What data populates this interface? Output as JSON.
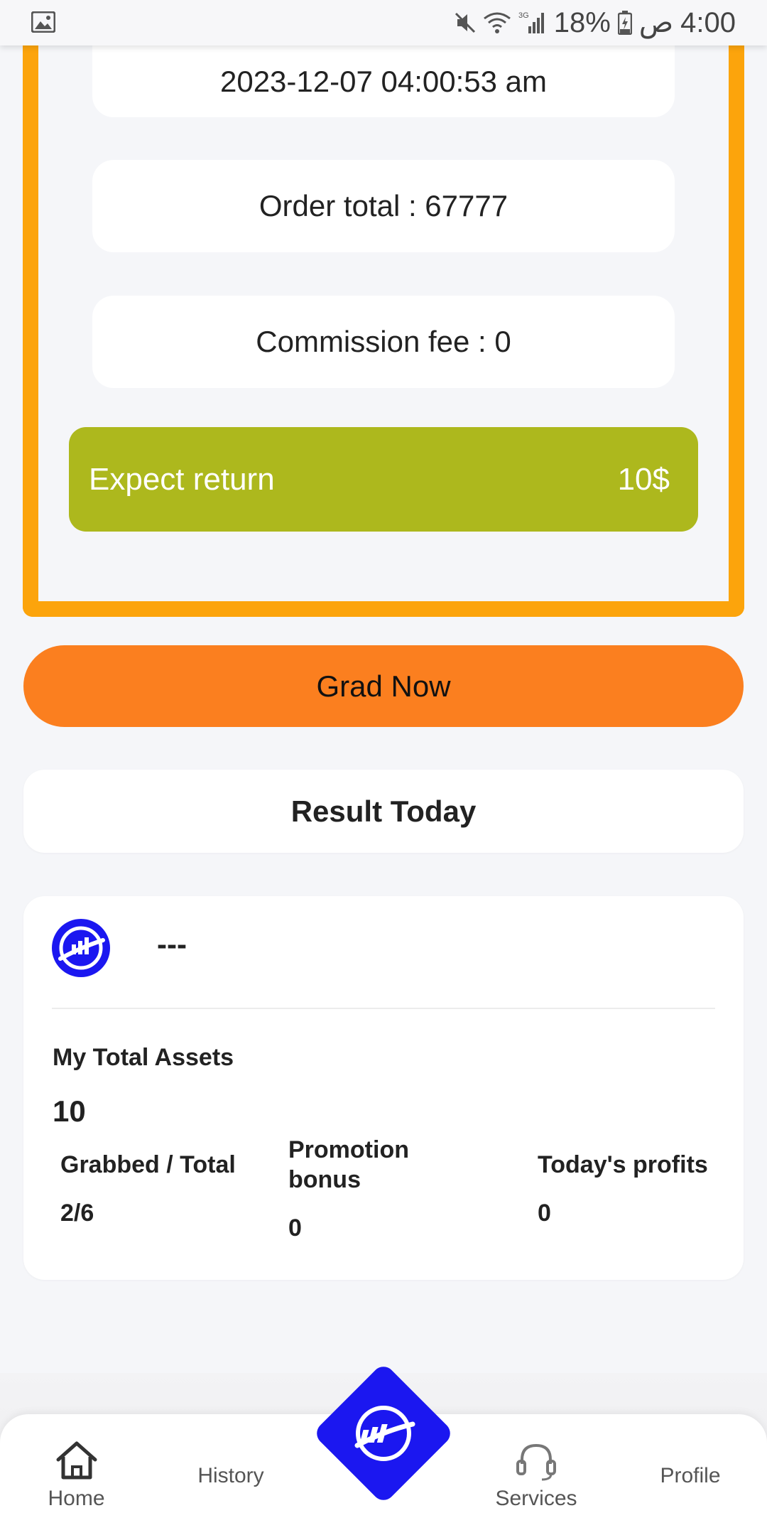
{
  "status_bar": {
    "battery": "18%",
    "time": "4:00",
    "am_pm_marker": "ص",
    "network": "3G",
    "icons": [
      "gallery-icon",
      "mute-icon",
      "wifi-icon",
      "signal-icon",
      "battery-icon"
    ]
  },
  "order": {
    "datetime": "2023-12-07 04:00:53 am",
    "total": "Order total : 67777",
    "commission": "Commission fee : 0",
    "expect_label": "Expect return",
    "expect_value": "10$"
  },
  "actions": {
    "grab_label": "Grad Now"
  },
  "result": {
    "title": "Result Today"
  },
  "assets": {
    "user_name": "---",
    "title": "My Total Assets",
    "total": "10",
    "grabbed_label": "Grabbed / Total",
    "grabbed_value": "2/6",
    "promotion_label_line1": "Promotion",
    "promotion_label_line2": "bonus",
    "promotion_value": "0",
    "profits_label": "Today's profits",
    "profits_value": "0"
  },
  "nav": {
    "home": "Home",
    "history": "History",
    "services": "Services",
    "profile": "Profile"
  },
  "colors": {
    "frame": "#fca40c",
    "expect_bg": "#adb81d",
    "grab_button": "#fb7f1f",
    "brand_blue": "#1b17f0"
  }
}
